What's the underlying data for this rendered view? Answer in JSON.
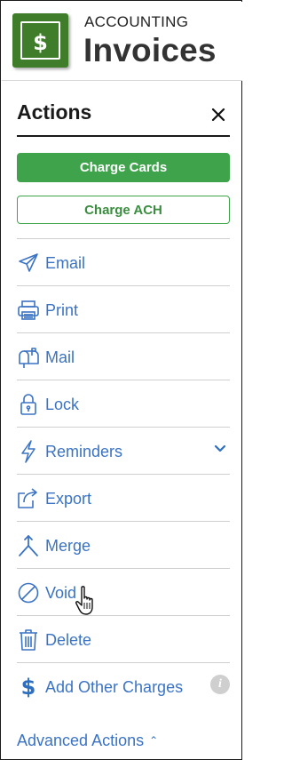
{
  "header": {
    "eyebrow": "ACCOUNTING",
    "title": "Invoices",
    "logo_symbol": "$",
    "logo_color": "#3f7d2a"
  },
  "panel": {
    "title": "Actions",
    "close_icon": "close-icon"
  },
  "buttons": {
    "charge_cards": "Charge Cards",
    "charge_ach": "Charge ACH",
    "accent": "#3ea34a"
  },
  "actions": [
    {
      "label": "Email",
      "icon": "send-icon"
    },
    {
      "label": "Print",
      "icon": "printer-icon"
    },
    {
      "label": "Mail",
      "icon": "mailbox-icon"
    },
    {
      "label": "Lock",
      "icon": "lock-icon"
    },
    {
      "label": "Reminders",
      "icon": "lightning-icon",
      "expand_icon": "chevron-down-icon"
    },
    {
      "label": "Export",
      "icon": "export-icon"
    },
    {
      "label": "Merge",
      "icon": "merge-icon"
    },
    {
      "label": "Void",
      "icon": "void-icon"
    },
    {
      "label": "Delete",
      "icon": "trash-icon"
    },
    {
      "label": "Add Other Charges",
      "icon": "dollar-icon",
      "info_icon": "info-icon",
      "dollar_symbol": "$",
      "info_symbol": "i"
    }
  ],
  "advanced": {
    "label": "Advanced Actions",
    "toggle_symbol": "⌃"
  },
  "link_color": "#3b73c4"
}
